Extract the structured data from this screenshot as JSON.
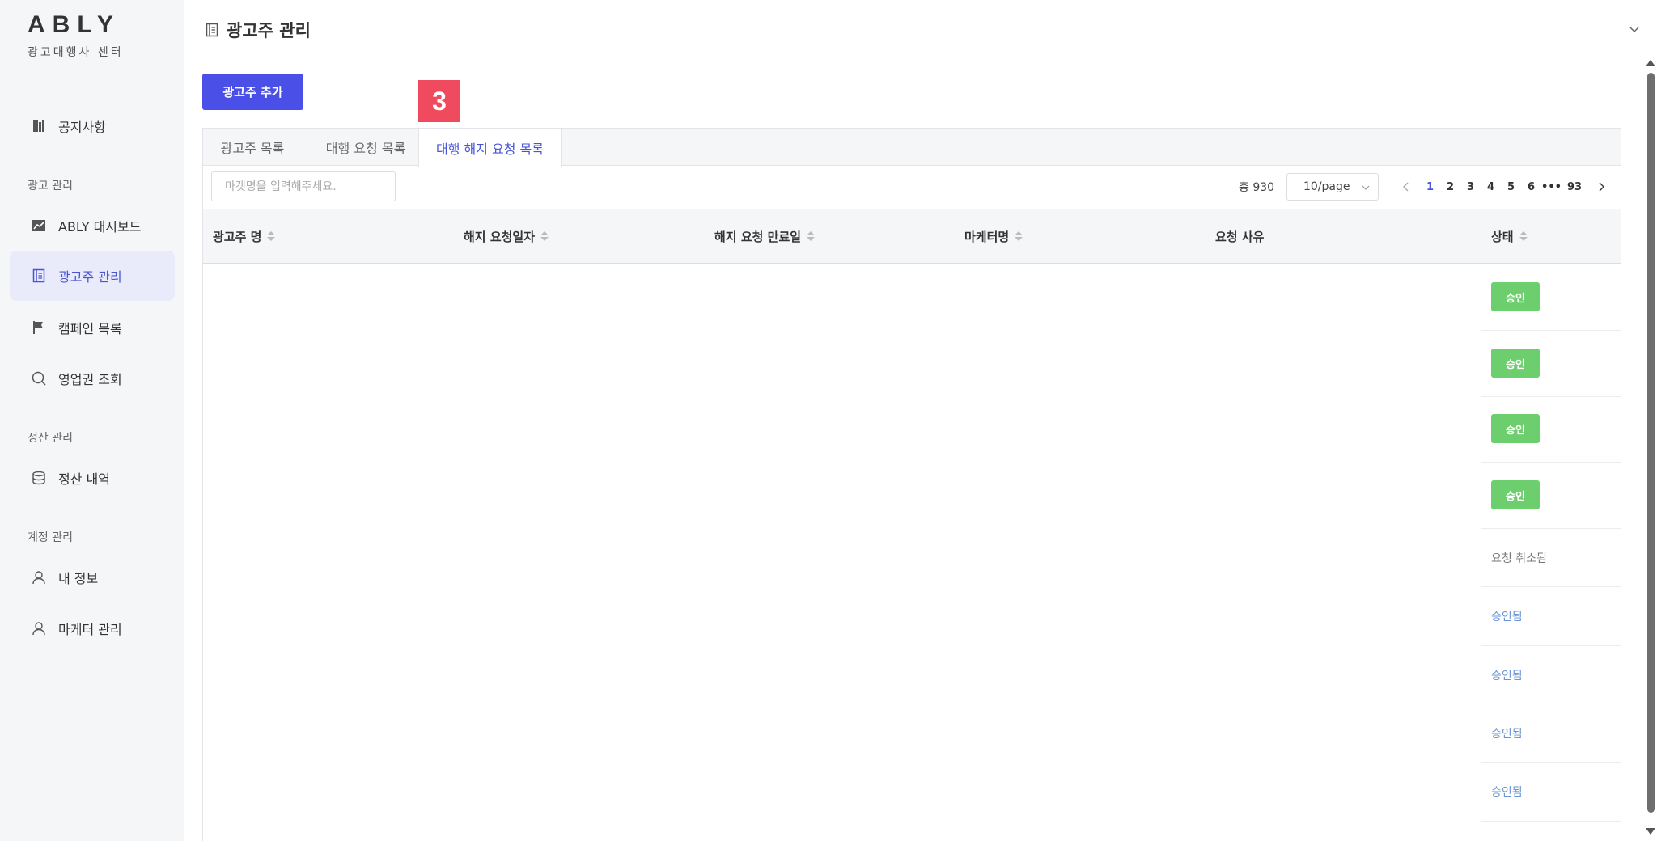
{
  "brand": {
    "logo": "ABLY",
    "subtitle": "광고대행사 센터"
  },
  "sidebar": {
    "notice": "공지사항",
    "sections": {
      "ads": "광고 관리",
      "settlement": "정산 관리",
      "account": "계정 관리"
    },
    "items": {
      "dashboard": "ABLY 대시보드",
      "advertiser": "광고주 관리",
      "campaign": "캠페인 목록",
      "territory": "영업권 조회",
      "settlement": "정산 내역",
      "myinfo": "내 정보",
      "marketer": "마케터 관리"
    },
    "active_item": "advertiser"
  },
  "header": {
    "title": "광고주 관리"
  },
  "toolbar": {
    "add_button": "광고주 추가",
    "step_badge": "3"
  },
  "tabs": [
    "광고주 목록",
    "대행 요청 목록",
    "대행 해지 요청 목록"
  ],
  "active_tab": 2,
  "filter": {
    "search_placeholder": "마켓명을 입력해주세요.",
    "total": "총 930",
    "page_size": "10/page"
  },
  "pagination": {
    "pages": [
      "1",
      "2",
      "3",
      "4",
      "5",
      "6"
    ],
    "ellipsis": "•••",
    "last": "93",
    "current": "1"
  },
  "table": {
    "columns": [
      "광고주 명",
      "해지 요청일자",
      "해지 요청 만료일",
      "마케터명",
      "요청 사유",
      "상태"
    ],
    "rows": [
      {
        "status": "승인",
        "kind": "tag"
      },
      {
        "status": "승인",
        "kind": "tag"
      },
      {
        "status": "승인",
        "kind": "tag"
      },
      {
        "status": "승인",
        "kind": "tag"
      },
      {
        "status": "요청 취소됨",
        "kind": "cancel"
      },
      {
        "status": "승인됨",
        "kind": "approved"
      },
      {
        "status": "승인됨",
        "kind": "approved"
      },
      {
        "status": "승인됨",
        "kind": "approved"
      },
      {
        "status": "승인됨",
        "kind": "approved"
      }
    ]
  },
  "colors": {
    "accent": "#4a4fe8",
    "badge": "#f04a5e",
    "tag_green": "#6cce6c",
    "link_blue": "#6b96d6"
  }
}
